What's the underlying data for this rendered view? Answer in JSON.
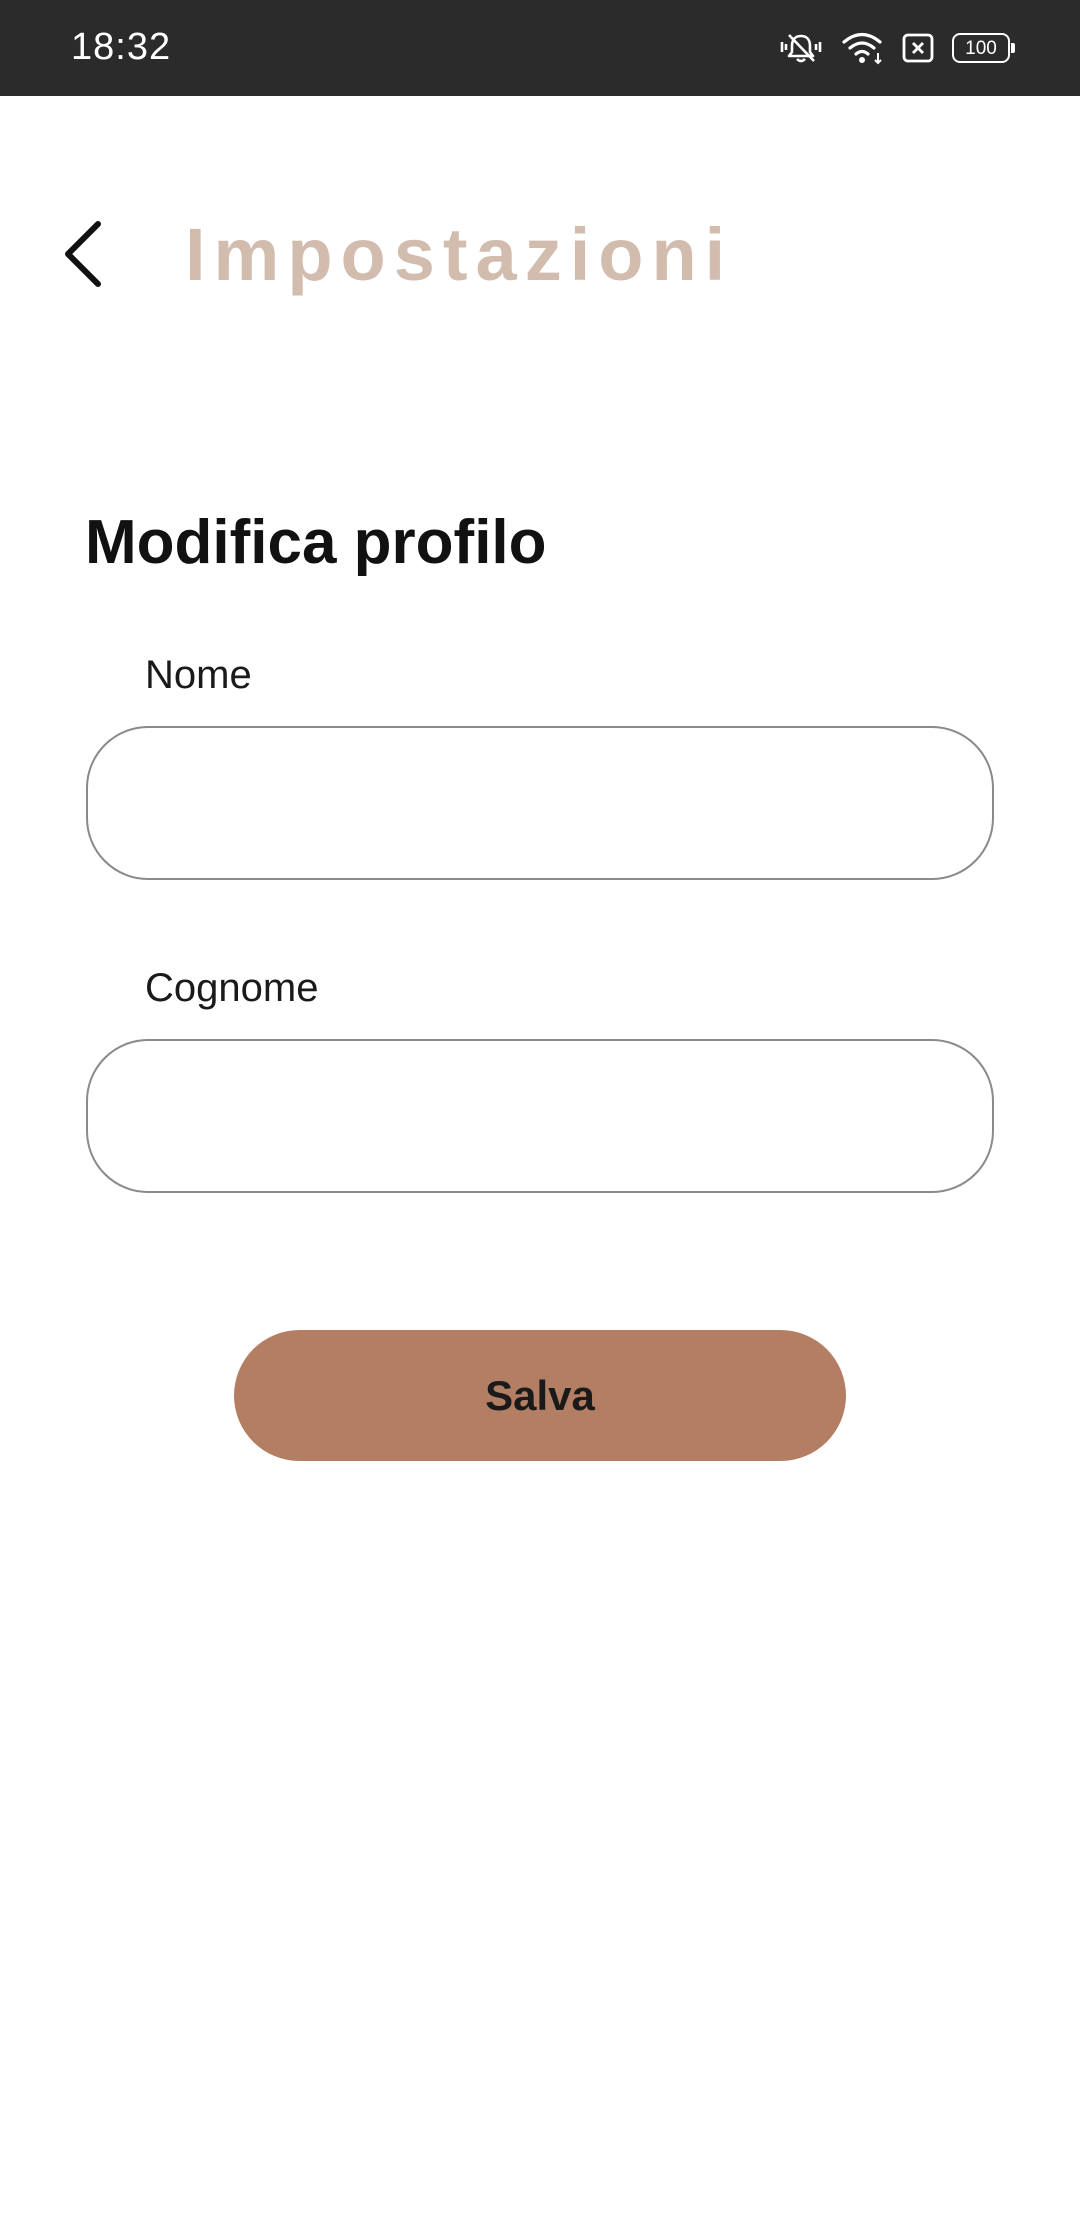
{
  "status_bar": {
    "time": "18:32",
    "icons": [
      "vibrate-mute-icon",
      "wifi-icon",
      "sim-x-icon",
      "battery-icon"
    ],
    "battery_level": "100"
  },
  "header": {
    "back_icon": "chevron-left-icon",
    "title": "Impostazioni"
  },
  "form": {
    "section_title": "Modifica profilo",
    "fields": [
      {
        "label": "Nome",
        "value": "",
        "placeholder": ""
      },
      {
        "label": "Cognome",
        "value": "",
        "placeholder": ""
      }
    ],
    "save_label": "Salva"
  },
  "colors": {
    "status_bar_bg": "#2b2b2b",
    "title_color": "#d2bcae",
    "button_color": "#b47e64",
    "input_border": "#8a8a8a"
  }
}
